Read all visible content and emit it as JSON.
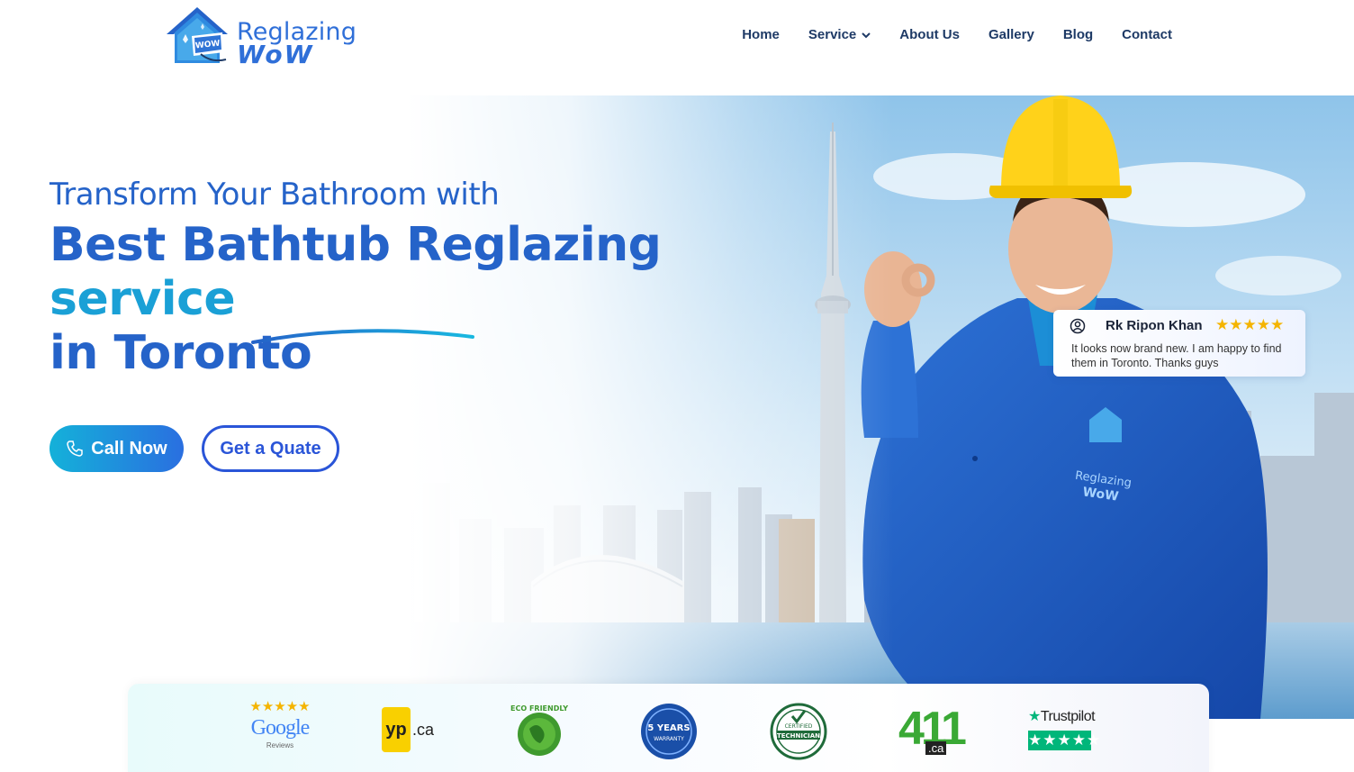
{
  "brand": {
    "line1": "Reglazing",
    "line2": "WoW",
    "badge_text": "WOW"
  },
  "nav": {
    "home": "Home",
    "service": "Service",
    "about": "About Us",
    "gallery": "Gallery",
    "blog": "Blog",
    "contact": "Contact"
  },
  "hero": {
    "subtitle": "Transform Your Bathroom with",
    "title_main": "Best Bathtub Reglazing ",
    "title_accent": "service",
    "title_line2": "in Toronto",
    "call_button": "Call Now",
    "quote_button": "Get a Quate",
    "jacket_text_1": "Reglazing",
    "jacket_text_2": "WoW"
  },
  "review": {
    "name": "Rk Ripon Khan",
    "stars": "★★★★★",
    "text": "It looks now brand new. I am happy to find them in Toronto. Thanks guys"
  },
  "badges": {
    "google_stars": "★★★★★",
    "google": "Google",
    "google_sub": "Reviews",
    "yp": "yp",
    "yp_ca": ".ca",
    "eco": "ECO FRIENDLY",
    "warranty_1": "5 YEARS",
    "warranty_2": "WARRANTY",
    "tech_1": "CERTIFIED",
    "tech_2": "TECHNICIAN",
    "four11": "411",
    "four11_ca": ".ca",
    "trustpilot": "Trustpilot",
    "trustpilot_stars": "★★★★★"
  },
  "colors": {
    "primary": "#2563c9",
    "accent": "#1aa0d6",
    "nav_text": "#1e3a66",
    "star": "#f4b400",
    "jacket": "#1f5fc4",
    "helmet": "#ffd21a"
  }
}
